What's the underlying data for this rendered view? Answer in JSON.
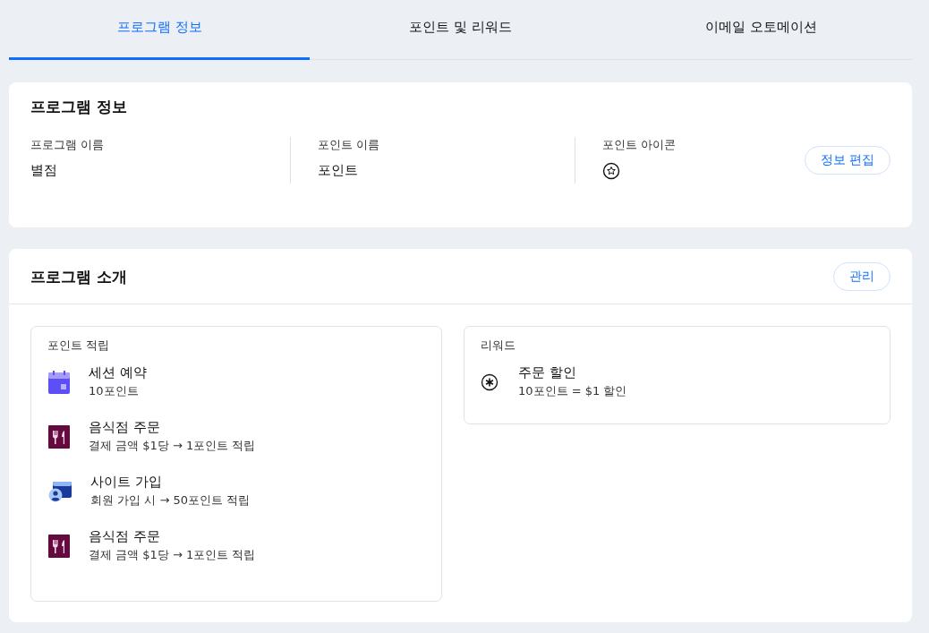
{
  "tabs": [
    {
      "label": "프로그램 정보",
      "selected": true
    },
    {
      "label": "포인트 및 리워드",
      "selected": false
    },
    {
      "label": "이메일 오토메이션",
      "selected": false
    }
  ],
  "program_info": {
    "title": "프로그램 정보",
    "fields": [
      {
        "label": "프로그램 이름",
        "value": "별점",
        "kind": "text"
      },
      {
        "label": "포인트 이름",
        "value": "포인트",
        "kind": "text"
      },
      {
        "label": "포인트 아이콘",
        "kind": "icon"
      }
    ],
    "edit_button": "정보 편집"
  },
  "program_intro": {
    "title": "프로그램 소개",
    "manage_button": "관리",
    "earn": {
      "title": "포인트 적립",
      "items": [
        {
          "kind": "calendar",
          "title": "세션 예약",
          "detail": "10포인트"
        },
        {
          "kind": "restaurant",
          "title": "음식점 주문",
          "detail": "결제 금액 $1당 → 1포인트 적립"
        },
        {
          "kind": "signup",
          "title": "사이트 가입",
          "detail": "회원 가입 시 → 50포인트 적립"
        },
        {
          "kind": "restaurant",
          "title": "음식점 주문",
          "detail": "결제 금액 $1당 → 1포인트 적립"
        }
      ]
    },
    "rewards": {
      "title": "리워드",
      "items": [
        {
          "title": "주문 할인",
          "detail": "10포인트 = $1 할인"
        }
      ]
    }
  }
}
